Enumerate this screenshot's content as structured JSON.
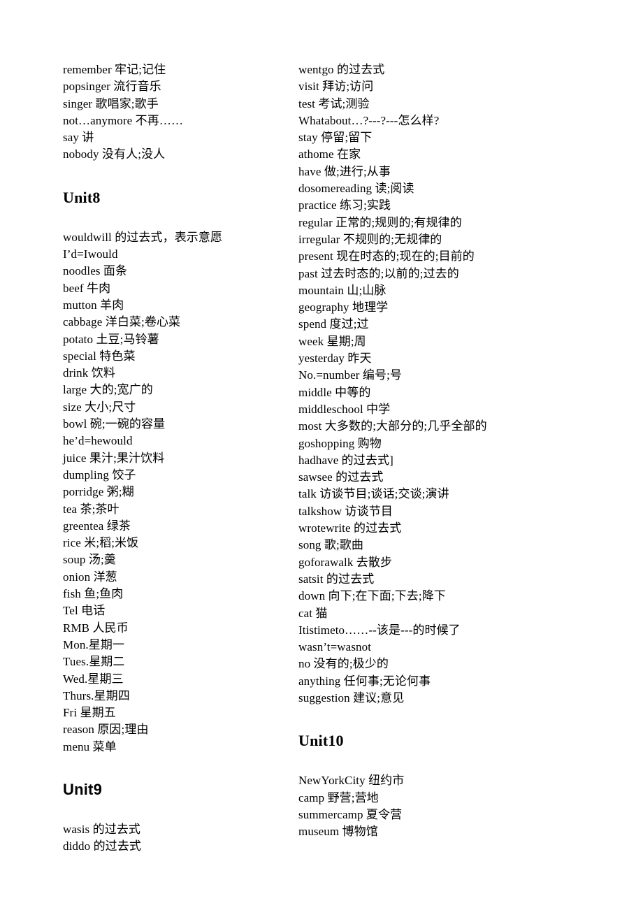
{
  "document": {
    "title": "英语单词表 Unit8-Unit10",
    "page_background": "#ffffff",
    "text_color": "#000000"
  },
  "columns": {
    "left": {
      "blocks": [
        {
          "type": "list",
          "entries": [
            "remember 牢记;记住",
            "popsinger 流行音乐",
            "singer 歌唱家;歌手",
            "not…anymore 不再……",
            "say 讲",
            "nobody 没有人;没人"
          ]
        },
        {
          "type": "heading",
          "label": "Unit8",
          "font": "serif"
        },
        {
          "type": "list",
          "entries": [
            "wouldwill 的过去式，表示意愿",
            "I’d=Iwould",
            "noodles 面条",
            "beef 牛肉",
            "mutton 羊肉",
            "cabbage 洋白菜;卷心菜",
            "potato 土豆;马铃薯",
            "special 特色菜",
            "drink 饮料",
            "large 大的;宽广的",
            "size 大小;尺寸",
            "bowl 碗;一碗的容量",
            "he’d=hewould",
            "juice 果汁;果汁饮料",
            "dumpling 饺子",
            "porridge 粥;糊",
            "tea 茶;茶叶",
            "greentea 绿茶",
            "rice 米;稻;米饭",
            "soup 汤;羮",
            "onion 洋葱",
            "fish 鱼;鱼肉",
            "Tel 电话",
            "RMB 人民币",
            "Mon.星期一",
            "Tues.星期二",
            "Wed.星期三",
            "Thurs.星期四",
            "Fri 星期五",
            "reason 原因;理由",
            "menu 菜单"
          ]
        },
        {
          "type": "heading",
          "label": "Unit9",
          "font": "sans"
        },
        {
          "type": "list",
          "entries": [
            "wasis 的过去式",
            "diddo 的过去式"
          ]
        }
      ]
    },
    "right": {
      "blocks": [
        {
          "type": "list",
          "entries": [
            "wentgo 的过去式",
            "visit 拜访;访问",
            "test 考试;测验",
            "Whatabout…?---?---怎么样?",
            "stay 停留;留下",
            "athome 在家",
            "have 做;进行;从事",
            "dosomereading 读;阅读",
            "practice 练习;实践",
            "regular 正常的;规则的;有规律的",
            "irregular 不规则的;无规律的",
            "present 现在时态的;现在的;目前的",
            "past 过去时态的;以前的;过去的",
            "mountain 山;山脉",
            "geography 地理学",
            "spend 度过;过",
            "week 星期;周",
            "yesterday 昨天",
            "No.=number 编号;号",
            "middle 中等的",
            "middleschool 中学",
            "most 大多数的;大部分的;几乎全部的",
            "goshopping 购物",
            "hadhave 的过去式]",
            "sawsee 的过去式",
            "talk 访谈节目;谈话;交谈;演讲",
            "talkshow 访谈节目",
            "wrotewrite 的过去式",
            "song 歌;歌曲",
            "goforawalk 去散步",
            "satsit 的过去式",
            "down 向下;在下面;下去;降下",
            "cat 猫",
            "Itistimeto……--该是---的时候了",
            "wasn’t=wasnot",
            "no 没有的;极少的",
            "anything 任何事;无论何事",
            "suggestion 建议;意见"
          ]
        },
        {
          "type": "heading",
          "label": "Unit10",
          "font": "serif"
        },
        {
          "type": "list",
          "entries": [
            "NewYorkCity 纽约市",
            "camp 野营;营地",
            "summercamp 夏令营",
            "museum 博物馆"
          ]
        }
      ]
    }
  }
}
